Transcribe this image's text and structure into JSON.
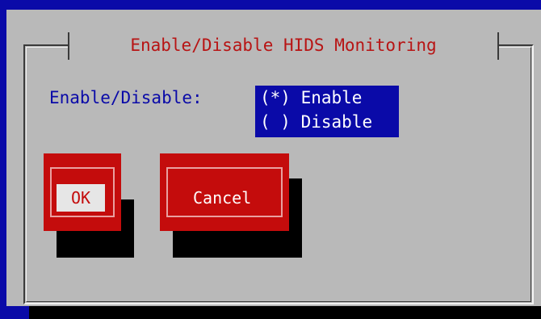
{
  "dialog": {
    "title": "Enable/Disable HIDS Monitoring"
  },
  "form": {
    "prompt_label": "Enable/Disable:",
    "options": [
      {
        "marker": "(*)",
        "label": "Enable",
        "selected": true
      },
      {
        "marker": "( )",
        "label": "Disable",
        "selected": false
      }
    ]
  },
  "buttons": {
    "ok_label": "OK",
    "cancel_label": "Cancel"
  },
  "colors": {
    "desktop": "#0a0aa8",
    "dialog_bg": "#b9b9b9",
    "title_text": "#b81414",
    "button_bg": "#c40c0c",
    "selection_bg": "#0a0aa8"
  }
}
